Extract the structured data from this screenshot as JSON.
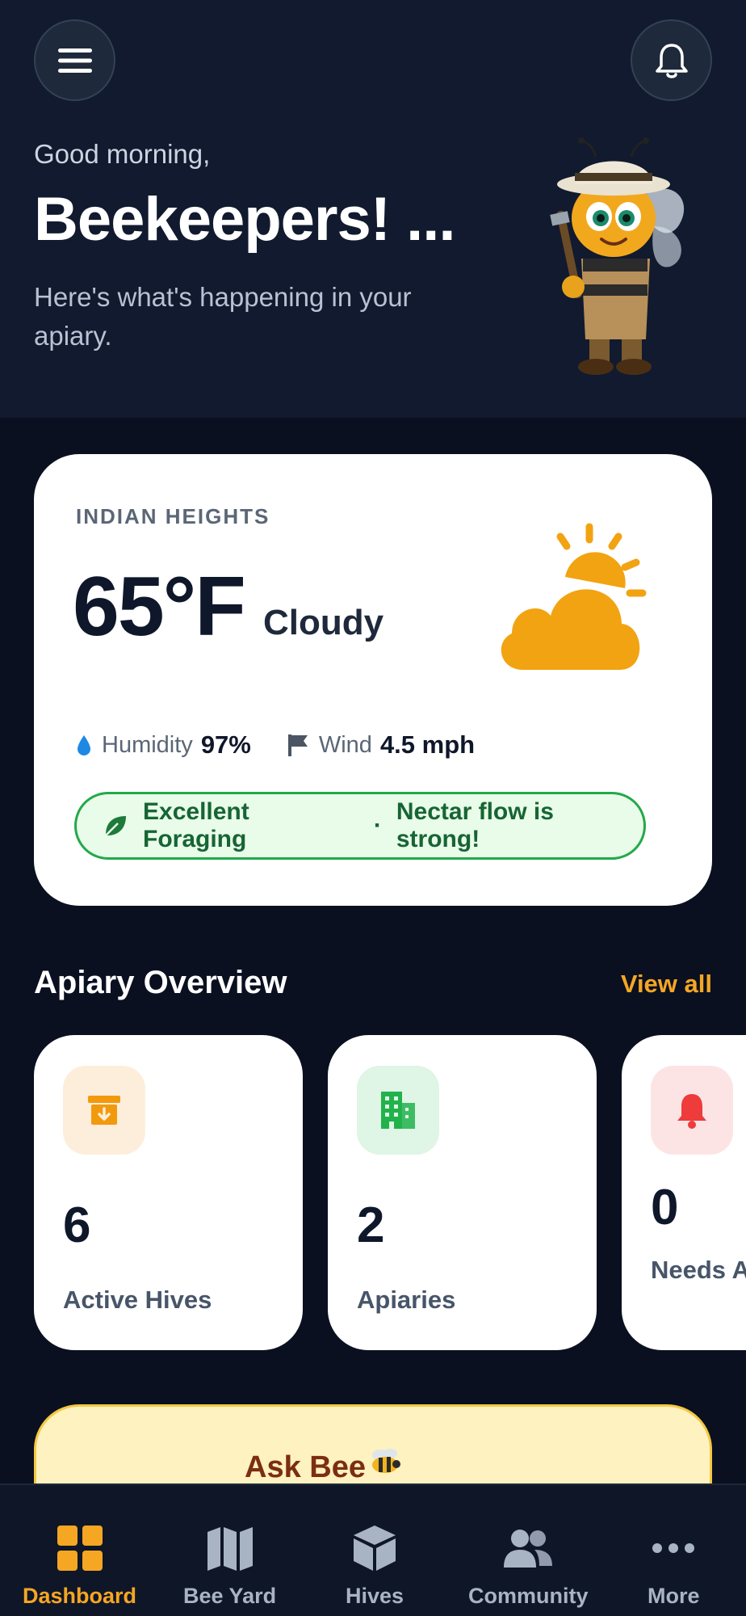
{
  "header": {
    "greeting": "Good morning,",
    "title": "Beekeepers! ...",
    "subtitle": "Here's what's happening in your apiary."
  },
  "weather": {
    "location": "INDIAN HEIGHTS",
    "temperature": "65°F",
    "condition": "Cloudy",
    "humidity_label": "Humidity",
    "humidity_value": "97%",
    "wind_label": "Wind",
    "wind_value": "4.5 mph",
    "forage_status": "Excellent Foraging",
    "forage_separator": "·",
    "forage_note": "Nectar flow is strong!"
  },
  "overview": {
    "title": "Apiary Overview",
    "view_all": "View all",
    "cards": [
      {
        "value": "6",
        "label": "Active Hives",
        "icon": "archive-icon"
      },
      {
        "value": "2",
        "label": "Apiaries",
        "icon": "building-icon"
      },
      {
        "value": "0",
        "label": "Needs Attention",
        "icon": "bell-icon"
      }
    ]
  },
  "ask": {
    "title": "Ask Bee"
  },
  "nav": {
    "items": [
      {
        "label": "Dashboard",
        "icon": "grid-icon",
        "active": true
      },
      {
        "label": "Bee Yard",
        "icon": "map-icon",
        "active": false
      },
      {
        "label": "Hives",
        "icon": "cube-icon",
        "active": false
      },
      {
        "label": "Community",
        "icon": "people-icon",
        "active": false
      },
      {
        "label": "More",
        "icon": "more-icon",
        "active": false
      }
    ]
  },
  "colors": {
    "background": "#0a1020",
    "header": "#111a2e",
    "accent": "#f5a623",
    "success": "#22a94a",
    "card": "#ffffff"
  }
}
